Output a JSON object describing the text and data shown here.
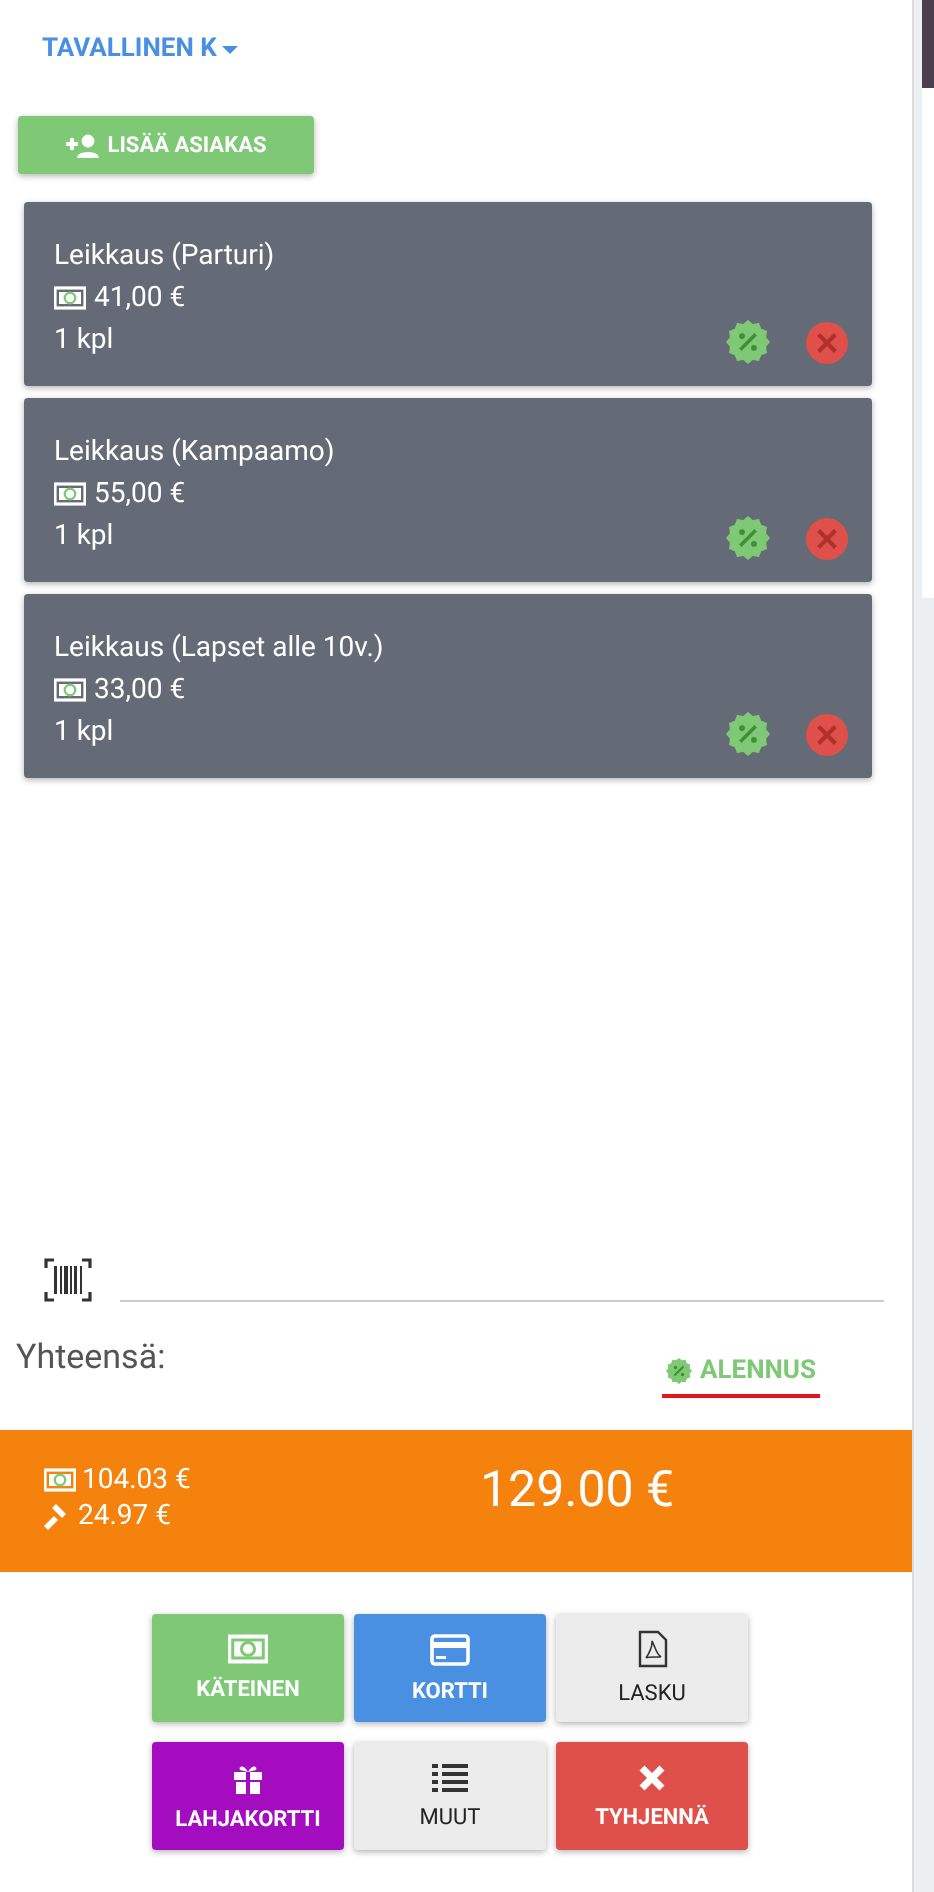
{
  "customer_type": {
    "label": "TAVALLINEN K"
  },
  "add_customer_button": {
    "label": "LISÄÄ ASIAKAS"
  },
  "cart_items": [
    {
      "name": "Leikkaus (Parturi)",
      "price": "41,00 €",
      "quantity": "1 kpl"
    },
    {
      "name": "Leikkaus (Kampaamo)",
      "price": "55,00 €",
      "quantity": "1 kpl"
    },
    {
      "name": "Leikkaus (Lapset alle 10v.)",
      "price": "33,00 €",
      "quantity": "1 kpl"
    }
  ],
  "total_label": "Yhteensä:",
  "discount_button": {
    "label": "ALENNUS"
  },
  "totals": {
    "net": "104.03 €",
    "tax": "24.97 €",
    "total": "129.00 €"
  },
  "payment_buttons": [
    {
      "kind": "cash",
      "label": "KÄTEINEN"
    },
    {
      "kind": "card",
      "label": "KORTTI"
    },
    {
      "kind": "invoice",
      "label": "LASKU"
    },
    {
      "kind": "gift",
      "label": "LAHJAKORTTI"
    },
    {
      "kind": "other",
      "label": "MUUT"
    },
    {
      "kind": "clear",
      "label": "TYHJENNÄ"
    }
  ]
}
